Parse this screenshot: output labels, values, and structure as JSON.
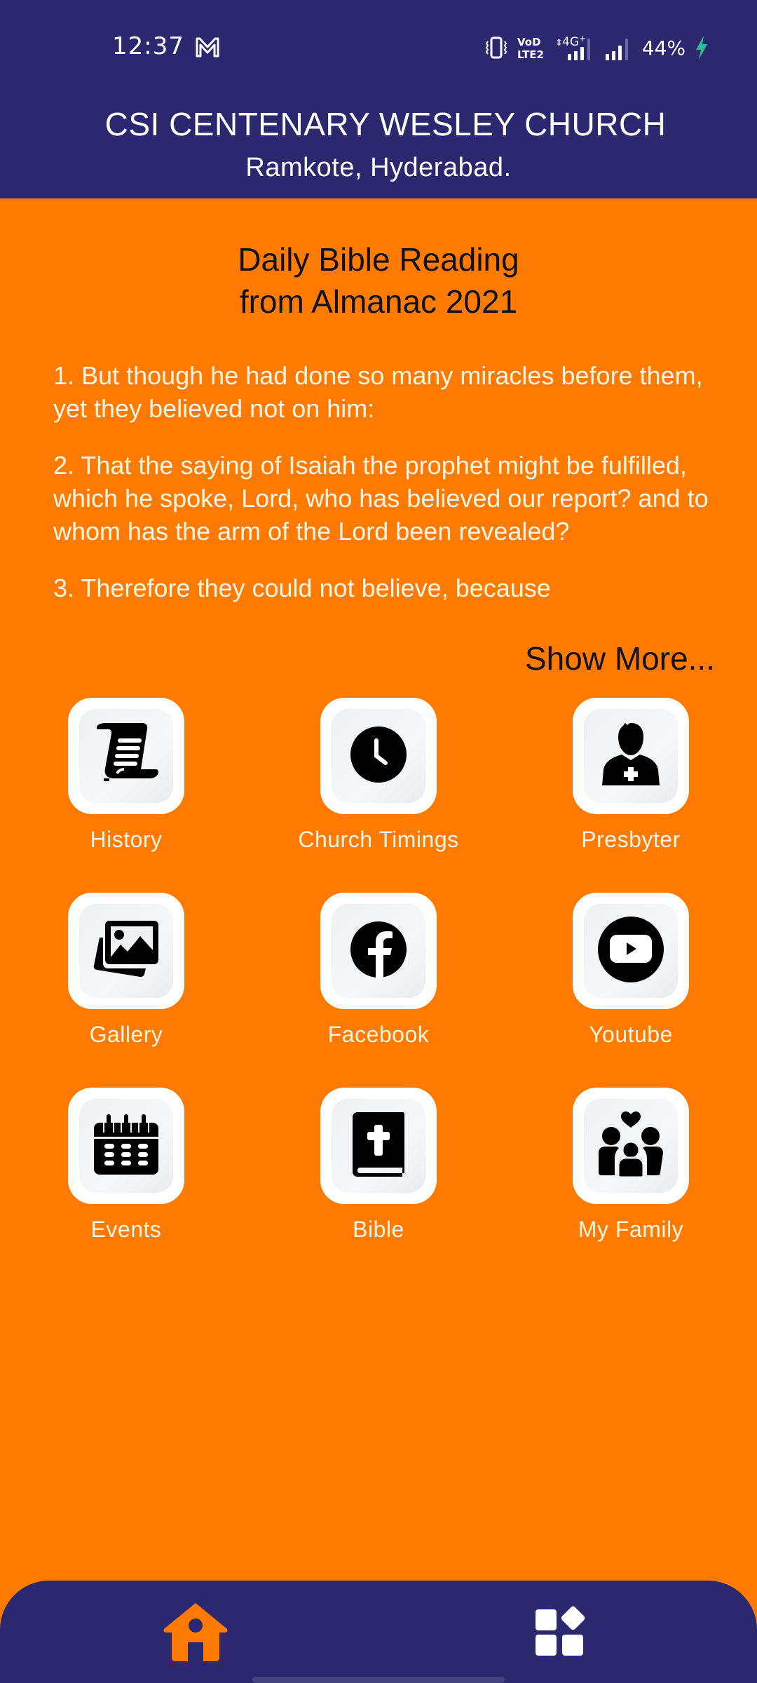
{
  "status_bar": {
    "time": "12:37",
    "notification_icons": [
      "gmail-icon"
    ],
    "system_icons": [
      "vibrate-icon",
      "volte-icon",
      "4g-plus-signal-icon",
      "signal-icon"
    ],
    "network_label": "4G+",
    "volte_label_top": "VoD",
    "volte_label_bottom": "LTE2",
    "battery_percent": "44%",
    "charging": true
  },
  "header": {
    "title": "CSI CENTENARY WESLEY CHURCH",
    "subtitle": "Ramkote, Hyderabad."
  },
  "reading": {
    "title_line1": "Daily Bible Reading",
    "title_line2": "from Almanac 2021",
    "verses": [
      "1. But though he had done so many miracles before them, yet they believed not on him:",
      "2. That the saying of Isaiah the prophet might be fulfilled, which he spoke, Lord, who has believed our report? and to whom has the arm of the Lord been revealed?",
      "3. Therefore they could not believe, because"
    ],
    "show_more_label": "Show More..."
  },
  "tiles": [
    {
      "label": "History",
      "icon": "scroll-icon"
    },
    {
      "label": "Church Timings",
      "icon": "clock-icon"
    },
    {
      "label": "Presbyter",
      "icon": "priest-icon"
    },
    {
      "label": "Gallery",
      "icon": "gallery-icon"
    },
    {
      "label": "Facebook",
      "icon": "facebook-icon"
    },
    {
      "label": "Youtube",
      "icon": "youtube-icon"
    },
    {
      "label": "Events",
      "icon": "calendar-icon"
    },
    {
      "label": "Bible",
      "icon": "bible-icon"
    },
    {
      "label": "My Family",
      "icon": "family-icon"
    }
  ],
  "bottom_nav": {
    "items": [
      {
        "name": "home",
        "icon": "home-icon",
        "active": true
      },
      {
        "name": "menu",
        "icon": "apps-grid-icon",
        "active": false
      }
    ]
  },
  "colors": {
    "primary_navy": "#2B2870",
    "accent_orange": "#FF7A00",
    "text_light": "#FFF6E8",
    "text_dark": "#111111",
    "charging_green": "#2BBF8A"
  }
}
